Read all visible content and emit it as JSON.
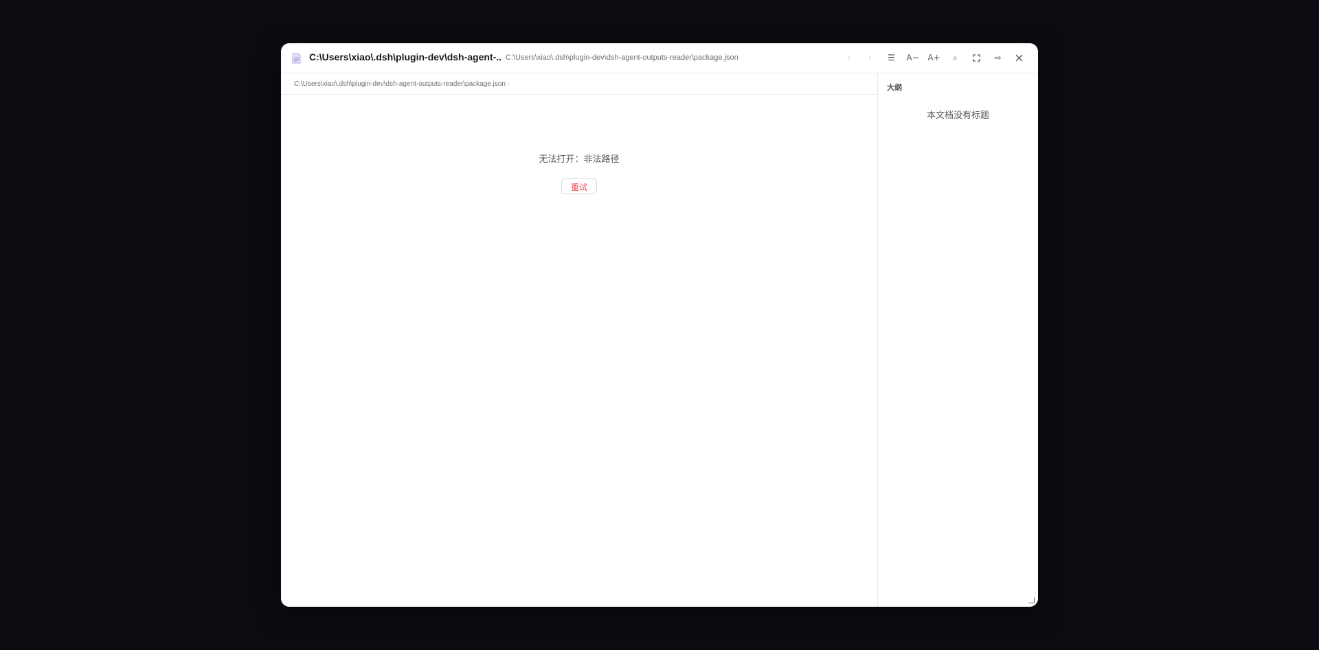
{
  "window": {
    "title": "C:\\Users\\xiao\\.dsh\\plugin-dev\\dsh-agent-...",
    "subtitle": "C:\\Users\\xiao\\.dsh\\plugin-dev\\dsh-agent-outputs-reader\\package.json"
  },
  "toolbar": {
    "back": "‹",
    "forward": "›",
    "outline": "☰",
    "font_smaller": "A−",
    "font_larger": "A+",
    "search": "⌕",
    "exit": "⇨"
  },
  "pathbar": {
    "path": "C:\\Users\\xiao\\.dsh\\plugin-dev\\dsh-agent-outputs-reader\\package.json ·"
  },
  "content": {
    "error_message": "无法打开：非法路径",
    "retry_label": "重试"
  },
  "sidebar": {
    "title": "大纲",
    "empty_text": "本文档没有标题"
  },
  "colors": {
    "background": "#0c0d12",
    "accent_error": "#e5484d",
    "window": "#ffffff"
  },
  "icons": [
    "document-icon",
    "fullscreen-icon",
    "close-icon",
    "resize-grip-icon"
  ]
}
